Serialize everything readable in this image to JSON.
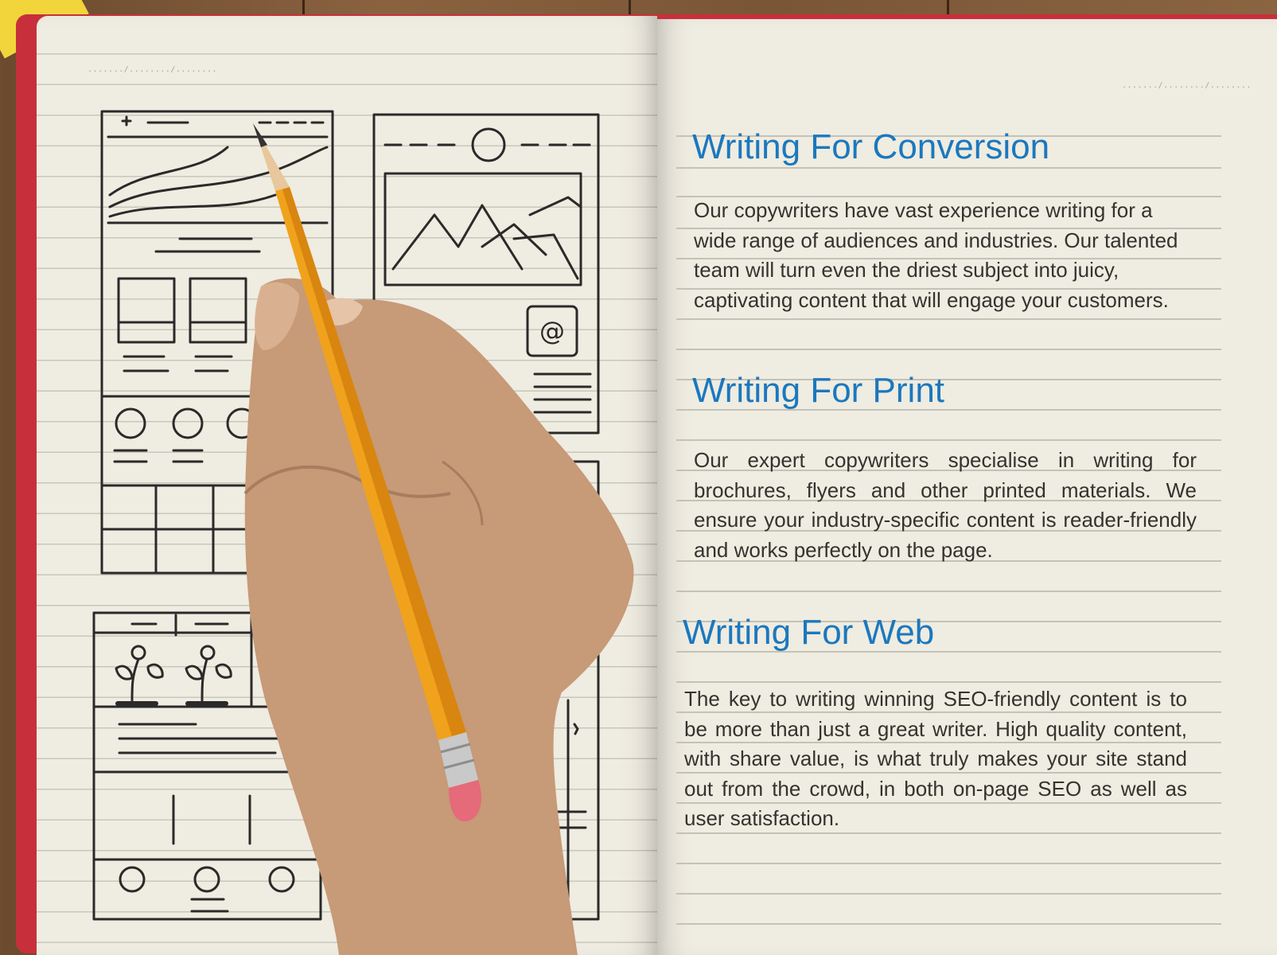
{
  "left_page": {
    "date_placeholder": "......./......../........"
  },
  "right_page": {
    "date_placeholder": "......./......../........",
    "sections": [
      {
        "heading": "Writing For Conversion",
        "body": "Our copywriters have vast experience writing for a wide range of audiences and industries. Our talented team will turn even the driest subject into juicy, captivating content that will engage your customers."
      },
      {
        "heading": "Writing For Print",
        "body": "Our expert copywriters specialise in writing for brochures, flyers and other printed materials. We ensure your industry-specific content is reader-friendly and works perfectly on the page."
      },
      {
        "heading": "Writing For Web",
        "body": "The key to writing winning SEO-friendly content is to be more than just a great writer. High quality content, with share value, is what truly makes your site stand out from the crowd, in both on-page SEO as well as user satisfaction."
      }
    ]
  },
  "sketch": {
    "email_symbol": "@"
  },
  "colors": {
    "heading": "#1b78be",
    "body_text": "#34332f",
    "notebook_cover": "#c7303b",
    "paper": "#efece1",
    "pencil": "#f0a21c",
    "sticky_note": "#f2d53a"
  }
}
